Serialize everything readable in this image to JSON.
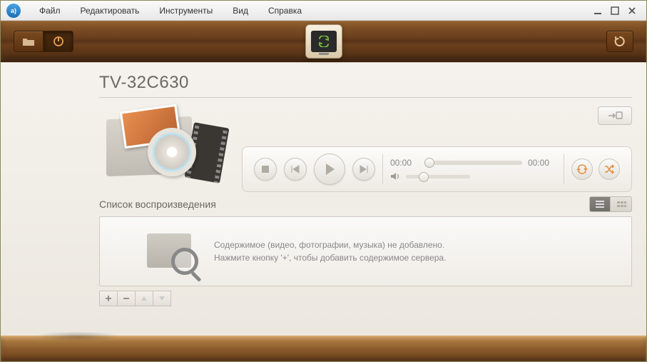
{
  "menu": {
    "file": "Файл",
    "edit": "Редактировать",
    "tools": "Инструменты",
    "view": "Вид",
    "help": "Справка"
  },
  "device": {
    "title": "TV-32C630"
  },
  "player": {
    "current": "00:00",
    "total": "00:00"
  },
  "playlist": {
    "title": "Список воспроизведения",
    "empty1": "Содержимое (видео, фотографии, музыка) не добавлено.",
    "empty2": "Нажмите кнопку '+', чтобы добавить содержимое сервера."
  }
}
